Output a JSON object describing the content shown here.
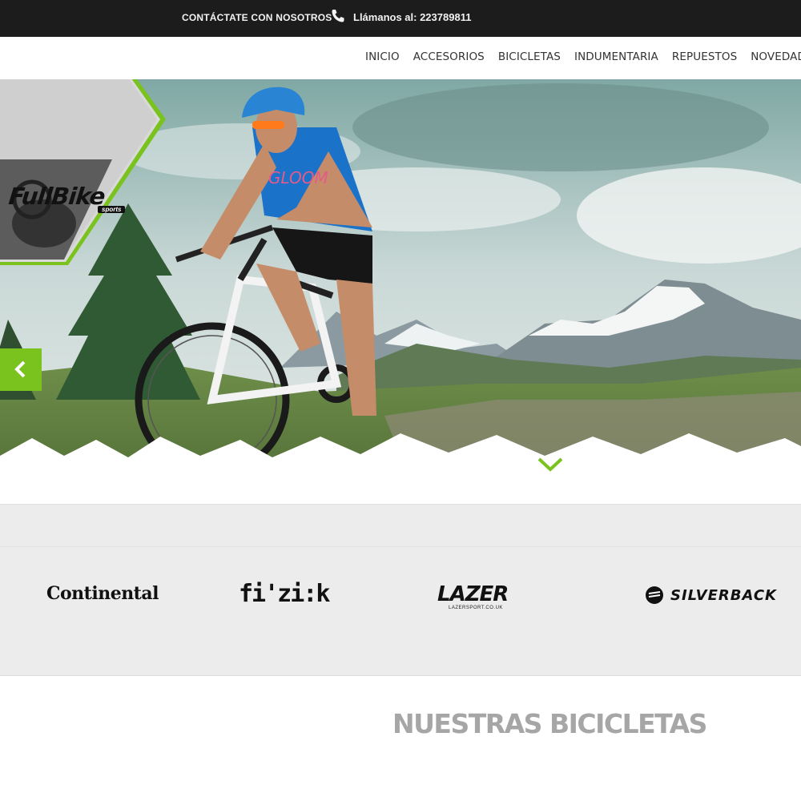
{
  "topbar": {
    "contact_label": "CONTÁCTATE CON NOSOTROS",
    "phone_icon": "phone-icon",
    "call_label": "Llámanos al: ",
    "phone_number": "223789811"
  },
  "nav": {
    "items": [
      "INICIO",
      "ACCESORIOS",
      "BICICLETAS",
      "INDUMENTARIA",
      "REPUESTOS",
      "NOVEDADES"
    ]
  },
  "logo": {
    "name": "FullBike",
    "sub": "sports",
    "accent_color": "#7ac21e"
  },
  "hero": {
    "prev_icon": "chevron-left-icon",
    "scroll_icon": "chevron-down-icon",
    "slides_count": 4,
    "active_slide": 3
  },
  "brands": [
    "Continental",
    "fi'zi:k",
    "LAZER",
    "SILVERBACK"
  ],
  "brand_sub": {
    "lazer": "LAZERSPORT.CO.UK"
  },
  "section": {
    "title": "NUESTRAS BICICLETAS"
  },
  "colors": {
    "accent": "#7ac21e",
    "topbar_bg": "#1c1c1c",
    "brands_bg": "#ececec",
    "title_gray": "#a6a6a6"
  }
}
